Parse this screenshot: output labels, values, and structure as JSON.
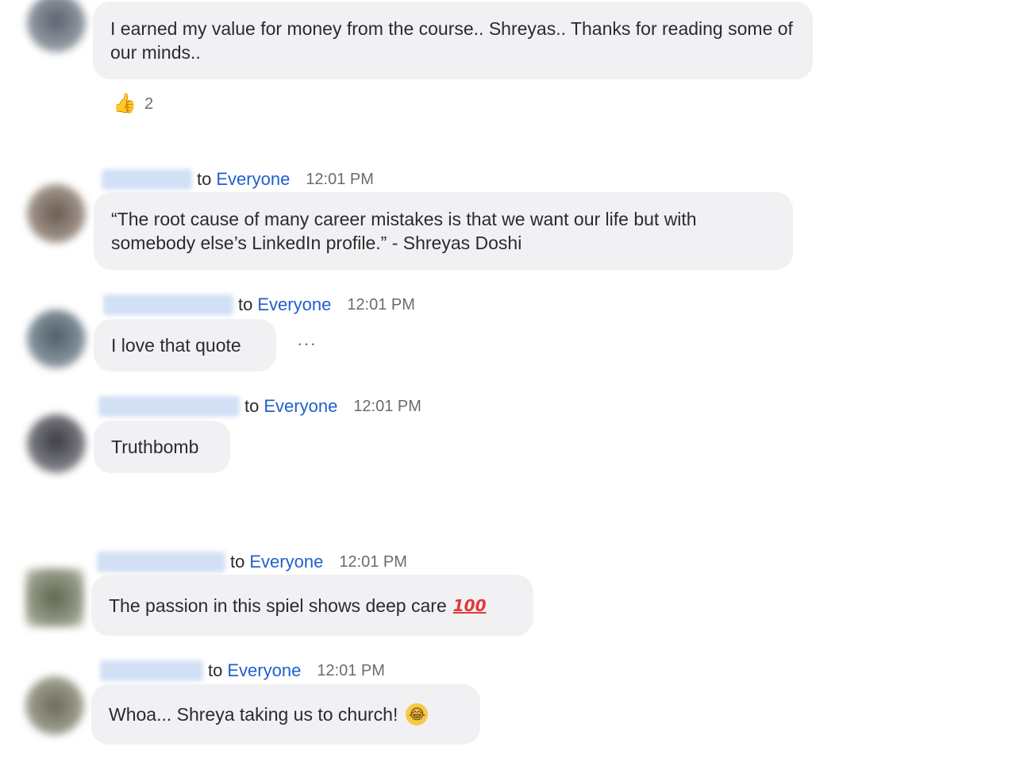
{
  "messages": [
    {
      "text": "I earned my value for money from the course.. Shreyas.. Thanks for reading some of our minds..",
      "reaction": {
        "icon": "thumbs-up-icon",
        "count": "2"
      }
    },
    {
      "to_label": "to",
      "recipient": "Everyone",
      "time": "12:01 PM",
      "text": "“The root cause of many career mistakes is that we want our life but with somebody else’s LinkedIn profile.” - Shreyas Doshi"
    },
    {
      "to_label": "to",
      "recipient": "Everyone",
      "time": "12:01 PM",
      "text": "I love that quote",
      "more": "···"
    },
    {
      "to_label": "to",
      "recipient": "Everyone",
      "time": "12:01 PM",
      "text": "Truthbomb"
    },
    {
      "to_label": "to",
      "recipient": "Everyone",
      "time": "12:01 PM",
      "text": "The passion in this spiel shows deep care",
      "emoji": "100"
    },
    {
      "to_label": "to",
      "recipient": "Everyone",
      "time": "12:01 PM",
      "text": "Whoa... Shreya taking us to church!",
      "emoji": "😂"
    }
  ],
  "colors": {
    "bubble": "#f1f1f4",
    "recipient": "#1f5fcf",
    "time": "#6b6b72"
  }
}
